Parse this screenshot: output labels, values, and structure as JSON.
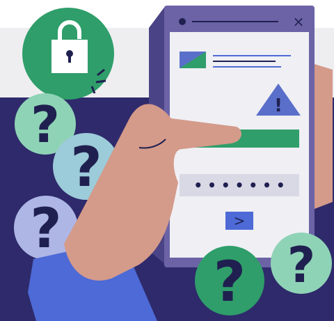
{
  "illustration": {
    "password_mask": "• • • • • • •",
    "window_close_glyph": "×",
    "submit_glyph": ">",
    "warning_glyph": "!",
    "question_glyph": "?"
  },
  "colors": {
    "top_band": "#eeeef1",
    "dark_band": "#2e2a6b",
    "phone_body": "#6b63a6",
    "phone_screen": "#efeff4",
    "green": "#2f9e6a",
    "mint": "#8fd3b6",
    "light_blue": "#9ccbd9",
    "lavender": "#aeb6e6",
    "hand": "#d49a8a",
    "sleeve": "#4d6ad6",
    "warning": "#5a6fc9"
  },
  "icons": [
    "lock-icon",
    "warning-icon",
    "question-mark-icon",
    "image-placeholder-icon",
    "arrow-right-icon",
    "close-icon"
  ]
}
